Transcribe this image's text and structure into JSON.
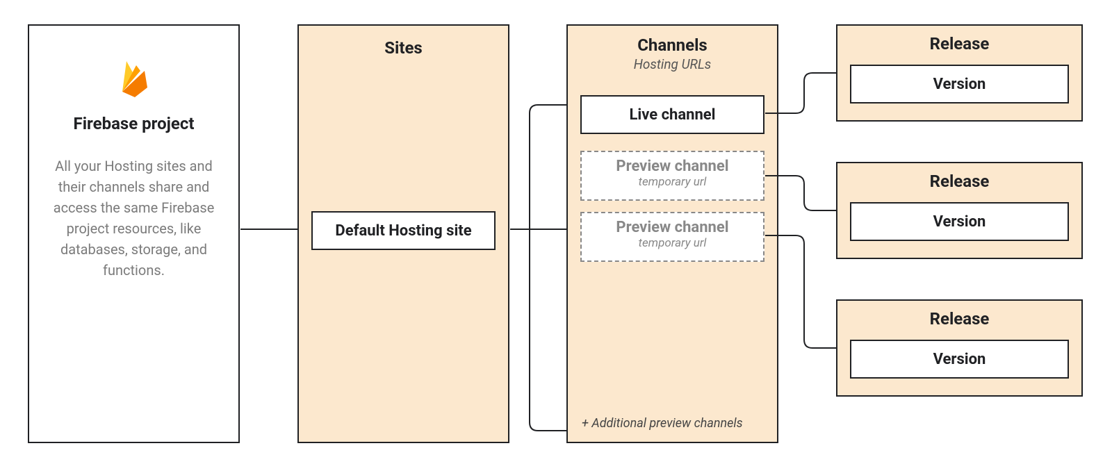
{
  "project": {
    "title": "Firebase project",
    "description": "All your Hosting sites and their channels share and access the same Firebase project resources, like databases, storage, and functions.",
    "icon": "firebase-logo-icon"
  },
  "sites": {
    "title": "Sites",
    "default_label": "Default Hosting site"
  },
  "channels": {
    "title": "Channels",
    "subtitle": "Hosting URLs",
    "live_label": "Live channel",
    "preview1": {
      "title": "Preview channel",
      "sub": "temporary url"
    },
    "preview2": {
      "title": "Preview channel",
      "sub": "temporary url"
    },
    "footer": "+ Additional preview channels"
  },
  "releases": [
    {
      "title": "Release",
      "version_label": "Version"
    },
    {
      "title": "Release",
      "version_label": "Version"
    },
    {
      "title": "Release",
      "version_label": "Version"
    }
  ]
}
